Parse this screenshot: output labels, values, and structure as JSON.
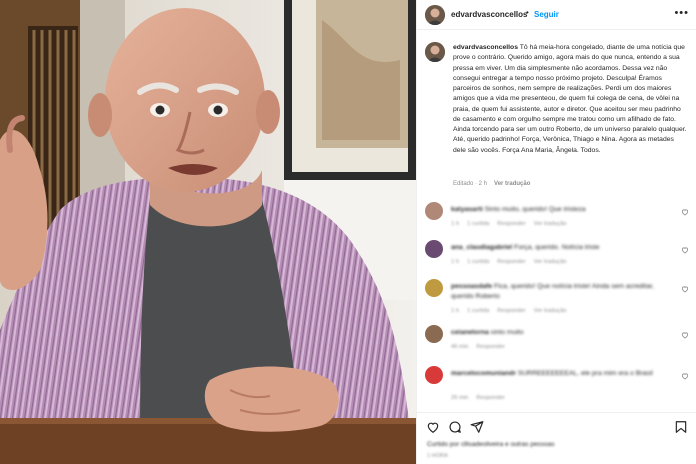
{
  "header": {
    "username": "edvardvasconcellos",
    "separator": "•",
    "follow_label": "Seguir",
    "more_icon": "more-horizontal-icon"
  },
  "caption": {
    "username": "edvardvasconcellos",
    "text": "Tô há meia-hora congelado, diante de uma notícia que prove o contrário. Querido amigo, agora mais do que nunca, entendo a sua pressa em viver. Um dia simplesmente não acordamos. Dessa vez não consegui entregar a tempo nosso próximo projeto. Desculpa! Éramos parceiros de sonhos, nem sempre de realizações. Perdi um dos maiores amigos que a vida me presenteou, de quem fui colega de cena, de vôlei na praia, de quem fui assistente, autor e diretor. Que aceitou ser meu padrinho de casamento e com orgulho sempre me tratou como um afilhado de fato. Ainda torcendo para ser um outro Roberto, de um universo paralelo qualquer. Até, querido padrinho! Força, Verônica, Thiago e Nina. Agora as metades dele são vocês. Força Ana Maria, Ângela. Todos.",
    "edited": "Editado · 2 h",
    "see_translation": "Ver tradução"
  },
  "comments": [
    {
      "username": "katyasarti",
      "text": "Sinto muito, querido! Que tristeza",
      "time": "1 h",
      "likes": "1 curtida",
      "reply": "Responder",
      "translate": "Ver tradução",
      "avatar_color": "#b08878"
    },
    {
      "username": "ana_claudiagabriel",
      "text": "Força, querido. Notícia triste",
      "time": "1 h",
      "likes": "1 curtida",
      "reply": "Responder",
      "translate": "Ver tradução",
      "avatar_color": "#6a4a70"
    },
    {
      "username": "pessoasdafe",
      "text": "Fica, querido! Que notícia triste! Ainda sem acreditar, querido Roberto",
      "time": "1 h",
      "likes": "1 curtida",
      "reply": "Responder",
      "translate": "Ver tradução",
      "avatar_color": "#c09a40"
    },
    {
      "username": "ceianelorna",
      "text": "sinto muito",
      "time": "46 min",
      "likes": "",
      "reply": "Responder",
      "translate": "",
      "avatar_color": "#8a6a50"
    },
    {
      "username": "marcelocomuniandr",
      "text": "SURREEEEEEEAL, ele pra mim era o Brasil",
      "time": "26 min",
      "likes": "",
      "reply": "Responder",
      "translate": "",
      "avatar_color": "#d83a3a"
    }
  ],
  "actions": {
    "like_icon": "heart-icon",
    "comment_icon": "comment-icon",
    "share_icon": "send-icon",
    "save_icon": "bookmark-icon"
  },
  "likes_text": "Curtido por cllisadeoliveira e outras pessoas",
  "date_text": "1 HORA"
}
